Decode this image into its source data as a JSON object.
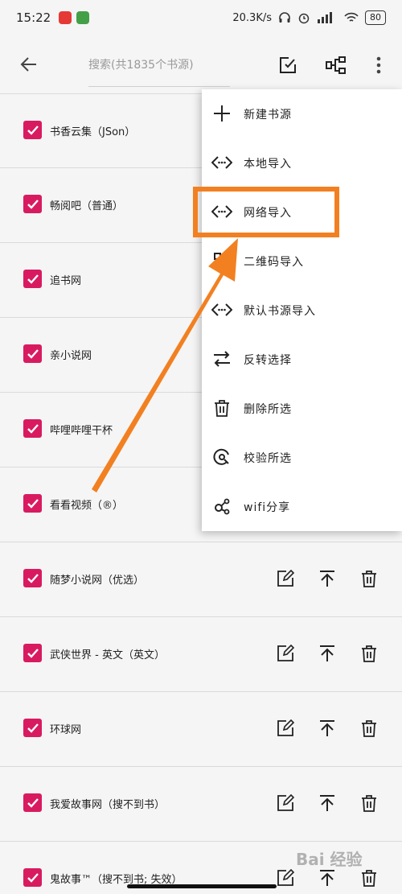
{
  "status_bar": {
    "time": "15:22",
    "speed": "20.3K/s",
    "battery": "80",
    "app_colors": [
      "#e53935",
      "#43a047"
    ]
  },
  "toolbar": {
    "search_placeholder": "搜索(共1835个书源)"
  },
  "sources": [
    {
      "name": "书香云集（JSon）"
    },
    {
      "name": "畅阅吧（普通）"
    },
    {
      "name": "追书网"
    },
    {
      "name": "亲小说网"
    },
    {
      "name": "哔哩哔哩干杯"
    },
    {
      "name": "看看视频（®）"
    },
    {
      "name": "随梦小说网（优选）"
    },
    {
      "name": "武侠世界 - 英文（英文）"
    },
    {
      "name": "环球网"
    },
    {
      "name": "我爱故事网（搜不到书）"
    },
    {
      "name": "鬼故事™（搜不到书; 失效）"
    }
  ],
  "menu": {
    "items": [
      {
        "label": "新建书源",
        "icon": "plus-icon"
      },
      {
        "label": "本地导入",
        "icon": "code-icon"
      },
      {
        "label": "网络导入",
        "icon": "code-icon"
      },
      {
        "label": "二维码导入",
        "icon": "qr-icon"
      },
      {
        "label": "默认书源导入",
        "icon": "code-icon"
      },
      {
        "label": "反转选择",
        "icon": "swap-icon"
      },
      {
        "label": "删除所选",
        "icon": "trash-icon"
      },
      {
        "label": "校验所选",
        "icon": "check-circle-icon"
      },
      {
        "label": "wifi分享",
        "icon": "share-icon"
      }
    ],
    "highlighted": "网络导入"
  },
  "colors": {
    "checkbox": "#d81b60",
    "highlight": "#f28021"
  },
  "watermark": "Bai 经验"
}
